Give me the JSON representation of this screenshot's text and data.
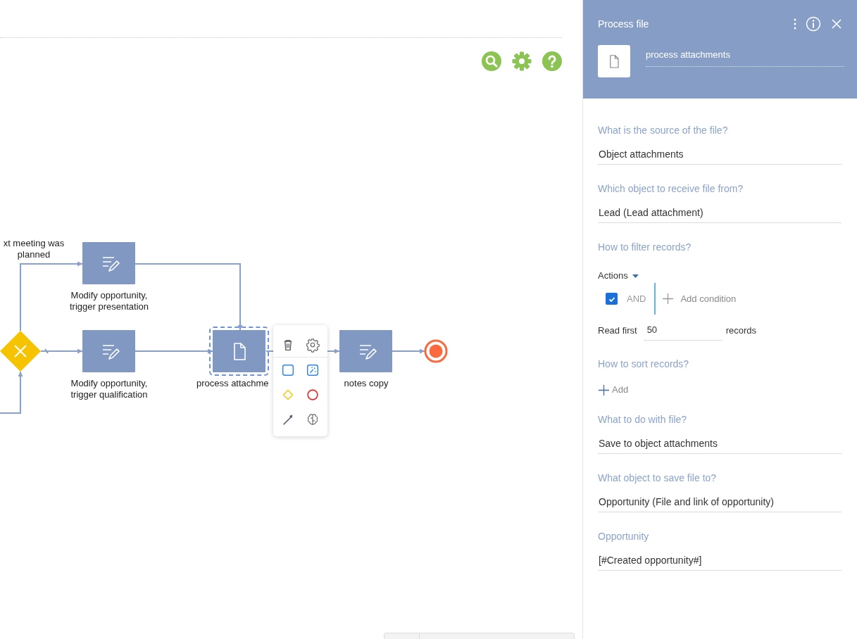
{
  "diagram": {
    "flow_labels": [
      {
        "text": "xt meeting was planned"
      }
    ],
    "nodes": [
      {
        "kind": "gateway"
      },
      {
        "kind": "user-task",
        "label": "Modify opportunity, trigger presentation",
        "selected": false
      },
      {
        "kind": "user-task",
        "label": "Modify opportunity, trigger qualification",
        "selected": false
      },
      {
        "kind": "file-task",
        "label": "process attachme",
        "selected": true
      },
      {
        "kind": "user-task",
        "label": "notes copy",
        "selected": false
      },
      {
        "kind": "end"
      }
    ]
  },
  "panel": {
    "title": "Process file",
    "element_name": "process attachments",
    "fields": [
      {
        "kind": "value",
        "label": "What is the source of the file?",
        "value": "Object attachments"
      },
      {
        "kind": "value",
        "label": "Which object to receive file from?",
        "value": "Lead (Lead attachment)"
      },
      {
        "kind": "filter",
        "label": "How to filter records?",
        "actions": "Actions",
        "group": {
          "checked": true,
          "operator": "AND"
        },
        "add_condition": "Add condition",
        "read_first": {
          "prefix": "Read first",
          "value": "50",
          "suffix": "records"
        }
      },
      {
        "kind": "sort",
        "label": "How to sort records?",
        "add": "Add"
      },
      {
        "kind": "value",
        "label": "What to do with file?",
        "value": "Save to object attachments"
      },
      {
        "kind": "value",
        "label": "What object to save file to?",
        "value": "Opportunity (File and link of opportunity)"
      },
      {
        "kind": "value",
        "label": "Opportunity",
        "value": "[#Created opportunity#]"
      }
    ]
  }
}
